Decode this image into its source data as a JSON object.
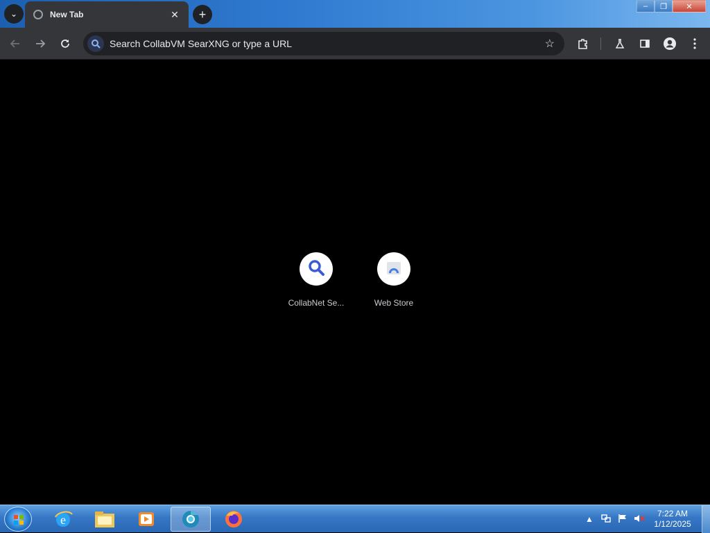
{
  "browser": {
    "tab": {
      "title": "New Tab"
    },
    "new_tab_symbol": "+",
    "window_controls": {
      "minimize": "–",
      "restore": "❐",
      "close": "✕"
    },
    "omnibox": {
      "placeholder": "Search CollabVM SearXNG or type a URL"
    }
  },
  "shortcuts": [
    {
      "label": "CollabNet Se...",
      "icon": "search-icon",
      "icon_color": "#3b5bd6"
    },
    {
      "label": "Web Store",
      "icon": "web-store-icon",
      "icon_color": "#4a7be0"
    }
  ],
  "taskbar": {
    "apps": [
      "start",
      "internet-explorer",
      "file-explorer",
      "media-player",
      "chromium",
      "firefox"
    ],
    "active_app": "chromium",
    "clock": {
      "time": "7:22 AM",
      "date": "1/12/2025"
    }
  }
}
